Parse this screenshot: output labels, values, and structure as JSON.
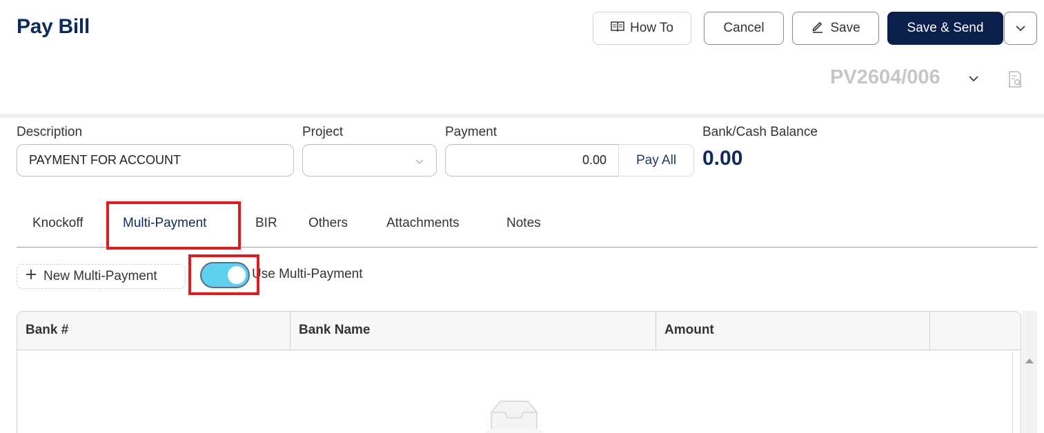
{
  "header": {
    "title": "Pay Bill"
  },
  "toolbar": {
    "how_to": "How To",
    "cancel": "Cancel",
    "save": "Save",
    "save_send": "Save & Send"
  },
  "document": {
    "number": "PV2604/006"
  },
  "form": {
    "description_label": "Description",
    "description_value": "PAYMENT FOR ACCOUNT",
    "project_label": "Project",
    "project_value": "",
    "payment_label": "Payment",
    "payment_value": "0.00",
    "pay_all": "Pay All",
    "balance_label": "Bank/Cash Balance",
    "balance_value": "0.00"
  },
  "tabs": [
    {
      "label": "Knockoff"
    },
    {
      "label": "Multi-Payment",
      "active": true
    },
    {
      "label": "BIR"
    },
    {
      "label": "Others"
    },
    {
      "label": "Attachments"
    },
    {
      "label": "Notes"
    }
  ],
  "multi_payment": {
    "new_button": "New Multi-Payment",
    "toggle_label": "Use Multi-Payment",
    "toggle_on": true
  },
  "table": {
    "columns": [
      "Bank #",
      "Bank Name",
      "Amount",
      ""
    ]
  },
  "colors": {
    "brand": "#0d2a5c",
    "primary_button": "#0b1f4d",
    "toggle_on": "#5fd1ef",
    "highlight": "#e01b1b"
  }
}
